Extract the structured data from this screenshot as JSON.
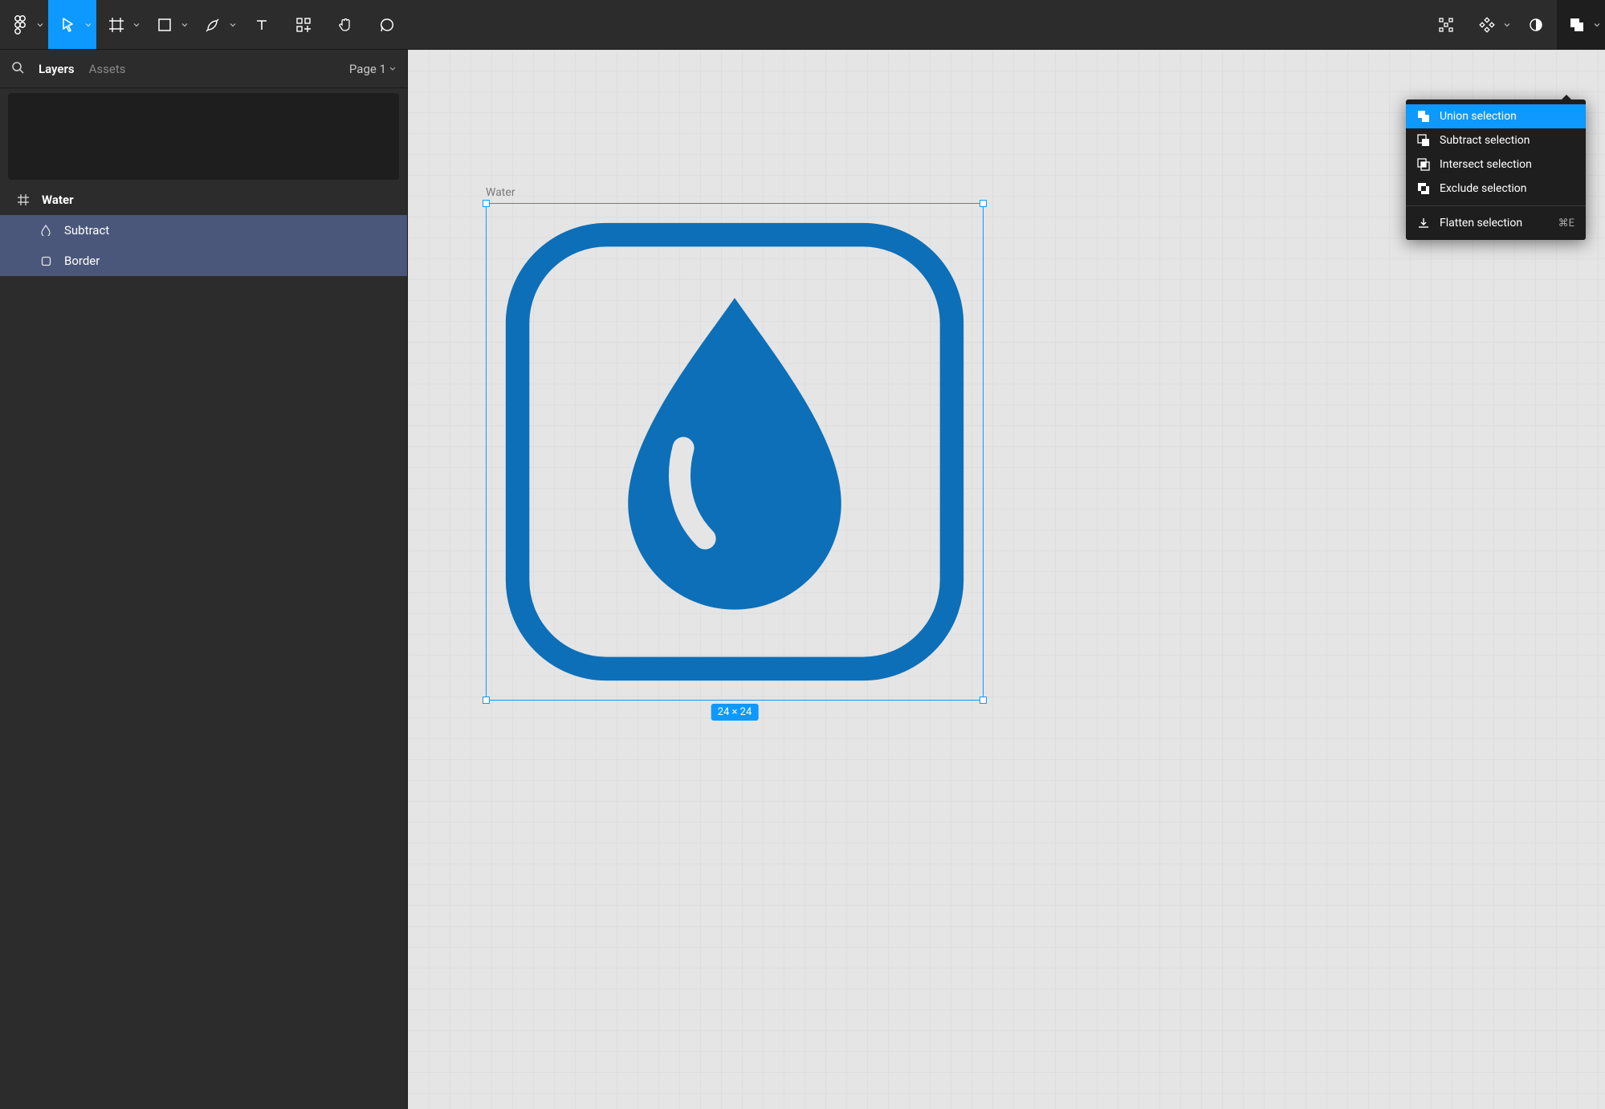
{
  "left_panel": {
    "tabs": {
      "layers": "Layers",
      "assets": "Assets"
    },
    "page_selector": "Page 1",
    "layers": {
      "parent": "Water",
      "children": [
        "Subtract",
        "Border"
      ]
    }
  },
  "canvas": {
    "frame_label": "Water",
    "selection_dim": "24 × 24",
    "icon_color": "#0d6fb8"
  },
  "dropdown": {
    "items": [
      {
        "label": "Union selection",
        "icon": "union-icon",
        "active": true
      },
      {
        "label": "Subtract selection",
        "icon": "subtract-icon"
      },
      {
        "label": "Intersect selection",
        "icon": "intersect-icon"
      },
      {
        "label": "Exclude selection",
        "icon": "exclude-icon"
      }
    ],
    "footer": {
      "label": "Flatten selection",
      "icon": "flatten-icon",
      "shortcut": "⌘E"
    }
  },
  "colors": {
    "accent": "#0d99ff",
    "panel": "#2c2c2c",
    "canvas_shape": "#0d6fb8"
  }
}
